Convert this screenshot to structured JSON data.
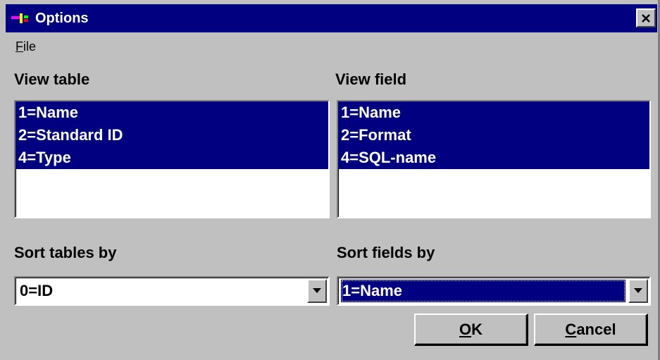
{
  "window": {
    "title": "Options",
    "close_glyph": "×"
  },
  "menubar": {
    "file": {
      "accel": "F",
      "rest": "ile"
    }
  },
  "view_table": {
    "label": "View table",
    "items": [
      "1=Name",
      "2=Standard ID",
      "4=Type"
    ]
  },
  "view_field": {
    "label": "View field",
    "items": [
      "1=Name",
      "2=Format",
      "4=SQL-name"
    ]
  },
  "sort_tables": {
    "label": "Sort tables by",
    "value": "0=ID"
  },
  "sort_fields": {
    "label": "Sort fields by",
    "value": "1=Name"
  },
  "buttons": {
    "ok": {
      "accel": "O",
      "rest": "K"
    },
    "cancel": {
      "accel": "C",
      "rest": "ancel"
    }
  },
  "colors": {
    "titlebar": "#000080",
    "selection": "#000080",
    "face": "#c0c0c0"
  }
}
